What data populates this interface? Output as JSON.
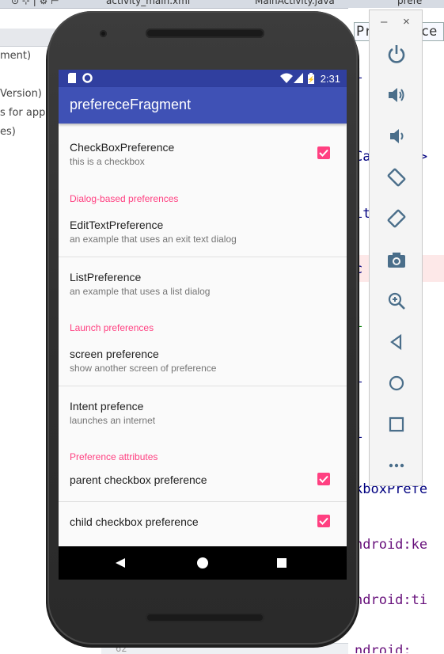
{
  "ide": {
    "tabs": [
      "activity_main.xml",
      "MainActivity.java",
      "prefe"
    ],
    "left_panel_lines": [
      "ment)",
      "Version)",
      "s for app",
      "es)"
    ],
    "inspect_box": "Preference",
    "gutter_line_number": "62",
    "code_lines": [
      "i    mar",
      "Category>",
      "it    r a",
      "c    en",
      "i    =\"s",
      "i    le",
      "i    mar",
      "kboxPrefe",
      "ndroid:ke",
      "ndroid:ti",
      "ndroid:"
    ]
  },
  "device": {
    "status_time": "2:31",
    "app_title": "prefereceFragment",
    "preferences": {
      "checkbox_title": "CheckBoxPreference",
      "checkbox_summary": "this is a checkbox",
      "checkbox_checked": true,
      "category_dialog": "Dialog-based preferences",
      "edittext_title": "EditTextPreference",
      "edittext_summary": "an example that uses an exit text dialog",
      "list_title": "ListPreference",
      "list_summary": "an example that uses a list dialog",
      "category_launch": "Launch preferences",
      "screen_title": "screen preference",
      "screen_summary": "show another screen of preference",
      "intent_title": "Intent prefence",
      "intent_summary": "launches an internet",
      "category_attributes": "Preference attributes",
      "parent_title": "parent checkbox preference",
      "parent_checked": true,
      "child_title": "child checkbox preference",
      "child_checked": true
    },
    "nav_buttons": [
      "back-icon",
      "home-icon",
      "recents-icon"
    ]
  },
  "emulator_toolbar": {
    "minimize": "–",
    "close": "×",
    "buttons": [
      "power-icon",
      "volume-up-icon",
      "volume-down-icon",
      "rotate-left-icon",
      "rotate-right-icon",
      "camera-icon",
      "zoom-icon",
      "back-icon",
      "home-icon",
      "overview-icon",
      "more-icon"
    ]
  },
  "colors": {
    "primary": "#3f51b5",
    "primary_dark": "#303f9f",
    "accent": "#ff4081"
  }
}
